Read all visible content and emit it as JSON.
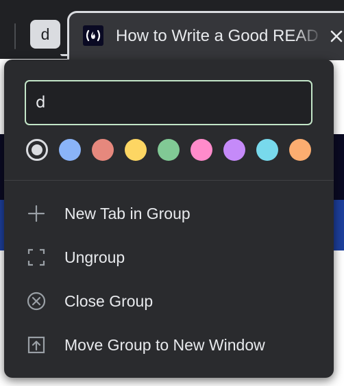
{
  "tab_group": {
    "chip_label": "d"
  },
  "active_tab": {
    "title": "How to Write a Good README",
    "favicon": "freecodecamp-logo",
    "close_icon": "close-icon"
  },
  "editor": {
    "name_value": "d",
    "colors": [
      {
        "name": "grey",
        "hex": "#dadce0",
        "selected": true
      },
      {
        "name": "blue",
        "hex": "#8ab4f8",
        "selected": false
      },
      {
        "name": "red",
        "hex": "#e6887d",
        "selected": false
      },
      {
        "name": "yellow",
        "hex": "#fdd663",
        "selected": false
      },
      {
        "name": "green",
        "hex": "#81c995",
        "selected": false
      },
      {
        "name": "pink",
        "hex": "#ff8bcb",
        "selected": false
      },
      {
        "name": "purple",
        "hex": "#c58af9",
        "selected": false
      },
      {
        "name": "cyan",
        "hex": "#78d9ec",
        "selected": false
      },
      {
        "name": "orange",
        "hex": "#fcad70",
        "selected": false
      }
    ]
  },
  "menu": {
    "items": [
      {
        "label": "New Tab in Group",
        "icon": "plus-icon"
      },
      {
        "label": "Ungroup",
        "icon": "ungroup-icon"
      },
      {
        "label": "Close Group",
        "icon": "close-circle-icon"
      },
      {
        "label": "Move Group to New Window",
        "icon": "move-window-icon"
      }
    ]
  },
  "theme": {
    "popup_bg": "#2a2b2e",
    "text": "#e8eaed",
    "input_border": "#c3e6c8"
  }
}
